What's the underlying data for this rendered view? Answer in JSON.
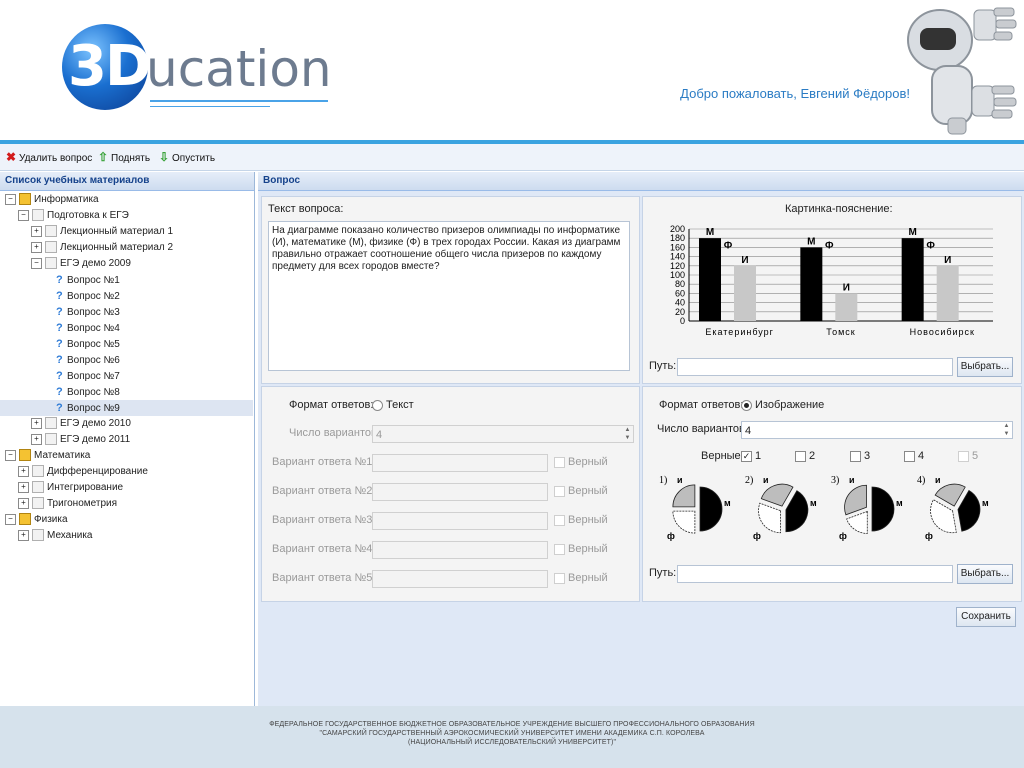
{
  "header": {
    "logo_prefix": "3D",
    "logo_rest": "ucation",
    "welcome": "Добро пожаловать, Евгений Фёдоров!"
  },
  "toolbar": {
    "delete_label": "Удалить вопрос",
    "up_label": "Поднять",
    "down_label": "Опустить"
  },
  "tree": {
    "title": "Список учебных материалов",
    "items": [
      {
        "label": "Информатика"
      },
      {
        "label": "Подготовка к ЕГЭ"
      },
      {
        "label": "Лекционный материал 1"
      },
      {
        "label": "Лекционный материал 2"
      },
      {
        "label": "ЕГЭ демо 2009"
      },
      {
        "label": "Вопрос №1"
      },
      {
        "label": "Вопрос №2"
      },
      {
        "label": "Вопрос №3"
      },
      {
        "label": "Вопрос №4"
      },
      {
        "label": "Вопрос №5"
      },
      {
        "label": "Вопрос №6"
      },
      {
        "label": "Вопрос №7"
      },
      {
        "label": "Вопрос №8"
      },
      {
        "label": "Вопрос №9"
      },
      {
        "label": "ЕГЭ демо 2010"
      },
      {
        "label": "ЕГЭ демо 2011"
      },
      {
        "label": "Математика"
      },
      {
        "label": "Дифференцирование"
      },
      {
        "label": "Интегрирование"
      },
      {
        "label": "Тригонометрия"
      },
      {
        "label": "Физика"
      },
      {
        "label": "Механика"
      }
    ]
  },
  "question": {
    "title": "Вопрос",
    "text_label": "Текст вопроса:",
    "text": "На диаграмме показано количество призеров олимпиады по информатике (И), математике (М), физике (Ф) в трех городах России. Какая из диаграмм правильно отражает соотношение общего числа призеров по каждому предмету для всех городов вместе?",
    "image_label": "Картинка-пояснение:",
    "path_label": "Путь:",
    "browse_label": "Выбрать...",
    "save_label": "Сохранить"
  },
  "text_answers": {
    "format_label": "Формат ответов:",
    "format_option": "Текст",
    "count_label": "Число вариантов:",
    "count_value": "4",
    "correct_label": "Верный",
    "variants": [
      "Вариант ответа №1:",
      "Вариант ответа №2:",
      "Вариант ответа №3:",
      "Вариант ответа №4:",
      "Вариант ответа №5:"
    ]
  },
  "image_answers": {
    "format_label": "Формат ответов:",
    "format_option": "Изображение",
    "count_label": "Число вариантов",
    "count_value": "4",
    "correct_label": "Верные:",
    "checks": [
      {
        "num": "1",
        "mark": "✓"
      },
      {
        "num": "2",
        "mark": ""
      },
      {
        "num": "3",
        "mark": ""
      },
      {
        "num": "4",
        "mark": ""
      },
      {
        "num": "5",
        "mark": ""
      }
    ],
    "pie_numbers": [
      "1)",
      "2)",
      "3)",
      "4)"
    ],
    "pie_letters": {
      "i": "и",
      "m": "м",
      "f": "ф"
    },
    "path_label": "Путь:",
    "browse_label": "Выбрать..."
  },
  "chart_data": {
    "type": "bar",
    "categories": [
      "Екатеринбург",
      "Томск",
      "Новосибирск"
    ],
    "series": [
      {
        "name": "М",
        "values": [
          180,
          160,
          180
        ]
      },
      {
        "name": "Ф",
        "values": [
          140,
          140,
          140
        ]
      },
      {
        "name": "И",
        "values": [
          120,
          60,
          120
        ]
      }
    ],
    "ylim": [
      0,
      200
    ],
    "yticks": [
      "200",
      "180",
      "160",
      "140",
      "120",
      "100",
      "80",
      "60",
      "40",
      "20",
      "0"
    ]
  },
  "footer": {
    "line1": "ФЕДЕРАЛЬНОЕ ГОСУДАРСТВЕННОЕ БЮДЖЕТНОЕ ОБРАЗОВАТЕЛЬНОЕ УЧРЕЖДЕНИЕ ВЫСШЕГО ПРОФЕССИОНАЛЬНОГО ОБРАЗОВАНИЯ",
    "line2": "\"САМАРСКИЙ ГОСУДАРСТВЕННЫЙ АЭРОКОСМИЧЕСКИЙ УНИВЕРСИТЕТ ИМЕНИ АКАДЕМИКА С.П. КОРОЛЕВА",
    "line3": "(НАЦИОНАЛЬНЫЙ ИССЛЕДОВАТЕЛЬСКИЙ УНИВЕРСИТЕТ)\""
  }
}
